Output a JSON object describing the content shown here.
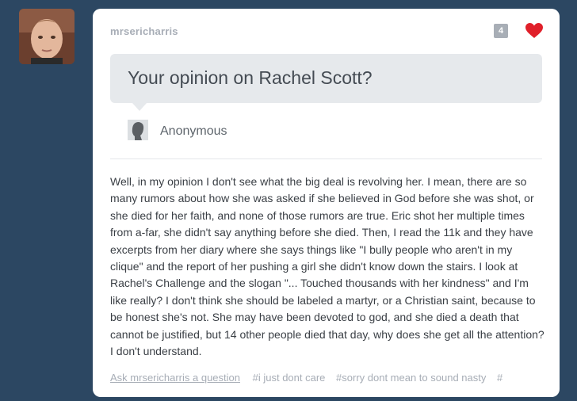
{
  "post": {
    "username": "mrsericharris",
    "note_count": "4",
    "question": "Your opinion on Rachel Scott?",
    "asker": "Anonymous",
    "answer": "Well, in my opinion I don't see what the big deal is revolving her. I mean, there are so many rumors about how she was asked if she believed in God before she was shot, or she died for her faith, and none of those rumors are true. Eric shot her multiple times from a-far, she didn't say anything before she died. Then, I read the 11k and they have excerpts from her diary where she says things like \"I bully people who aren't in my clique\" and the report of her pushing a girl she didn't know down the stairs. I look at Rachel's Challenge and the slogan \"... Touched thousands with her kindness\" and I'm like really? I don't think she should be labeled a martyr, or a Christian saint, because to be honest she's not. She may have been devoted to god, and she died a death that cannot be justified, but 14 other people died that day, why does she get all the attention? I don't understand.",
    "ask_link": "Ask mrsericharris a question",
    "tags": [
      "#i just dont care",
      "#sorry dont mean to sound nasty",
      "#"
    ]
  },
  "icons": {
    "like": "heart-icon",
    "asker_avatar": "anonymous-silhouette-icon"
  },
  "colors": {
    "background": "#2c4762",
    "like": "#e0202a",
    "question_bubble": "#e6e9ec"
  }
}
